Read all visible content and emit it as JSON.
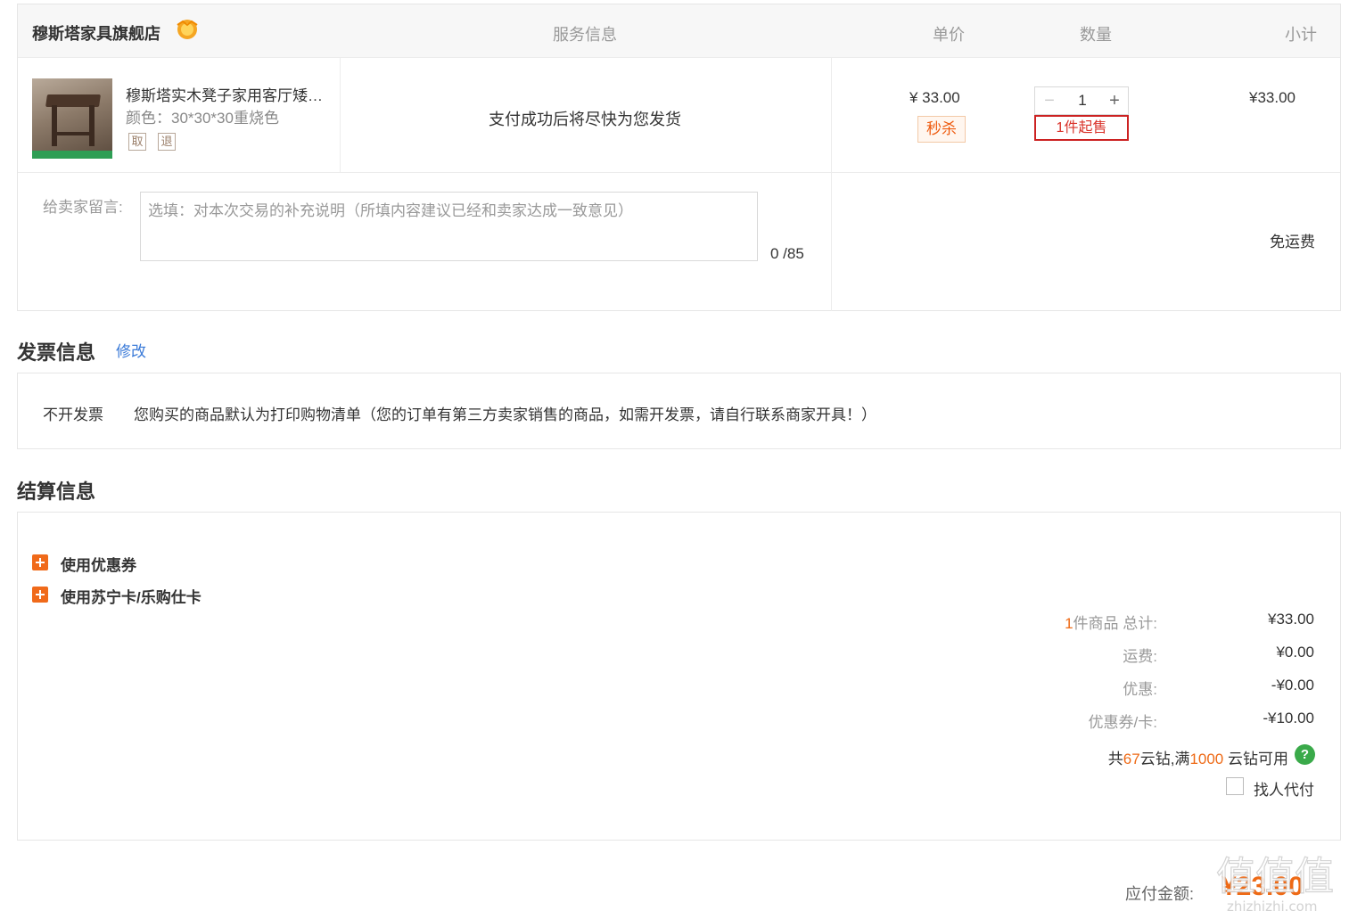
{
  "shop": {
    "name": "穆斯塔家具旗舰店",
    "badge_icon": "gold-shop-badge-icon"
  },
  "table_headers": {
    "service": "服务信息",
    "unit_price": "单价",
    "quantity": "数量",
    "subtotal": "小计"
  },
  "item": {
    "title": "穆斯塔实木凳子家用客厅矮…",
    "spec": "颜色：30*30*30重烧色",
    "tags": [
      "取",
      "退"
    ],
    "service": "支付成功后将尽快为您发货",
    "price": "¥ 33.00",
    "seckill": "秒杀",
    "quantity": "1",
    "min_sale": "1件起售",
    "subtotal": "¥33.00"
  },
  "message": {
    "label": "给卖家留言:",
    "placeholder": "选填：对本次交易的补充说明（所填内容建议已经和卖家达成一致意见）",
    "value": "",
    "count": "0 /85"
  },
  "shipping": "免运费",
  "invoice": {
    "title": "发票信息",
    "edit": "修改",
    "type": "不开发票",
    "note": "您购买的商品默认为打印购物清单（您的订单有第三方卖家销售的商品，如需开发票，请自行联系商家开具！）"
  },
  "settlement": {
    "title": "结算信息",
    "options": [
      "使用优惠券",
      "使用苏宁卡/乐购仕卡"
    ],
    "summary": {
      "item_count": "1",
      "item_label": "件商品 总计:",
      "item_total": "¥33.00",
      "freight_label": "运费:",
      "freight": "¥0.00",
      "discount_label": "优惠:",
      "discount": "-¥0.00",
      "coupon_label": "优惠券/卡:",
      "coupon": "-¥10.00"
    },
    "diamonds": {
      "prefix": "共",
      "count": "67",
      "mid": "云钻,满",
      "threshold": "1000",
      "suffix": "云钻可用",
      "help": "?"
    },
    "proxy_pay": "找人代付"
  },
  "payable": {
    "label": "应付金额:",
    "value": "¥23.00"
  },
  "watermark": {
    "glyphs": "值值值",
    "domain": "zhizhizhi.com"
  },
  "colors": {
    "accent": "#ee6a16",
    "link": "#3a7ad8",
    "alert": "#cc2222",
    "help": "#3aaa4a"
  }
}
